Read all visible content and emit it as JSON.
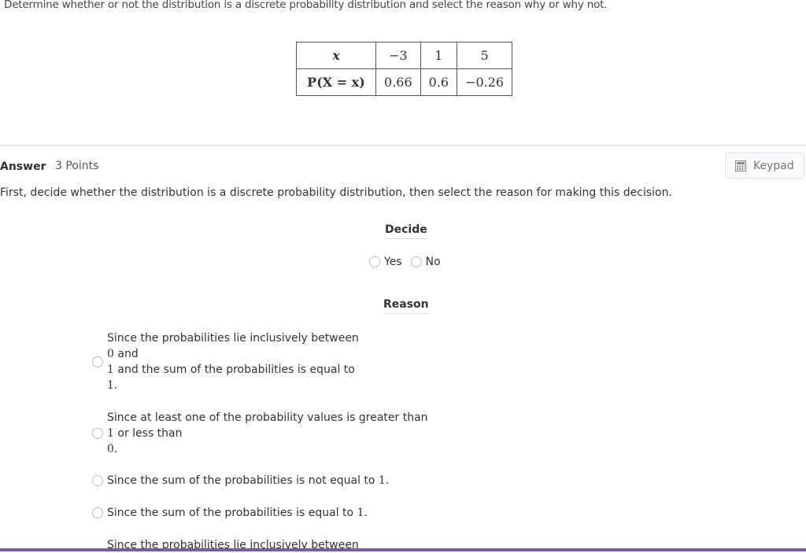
{
  "question": "Determine whether or not the distribution is a discrete probability distribution and select the reason why or why not.",
  "table": {
    "row_headers": [
      "x",
      "P(X = x)"
    ],
    "x_values": [
      "−3",
      "1",
      "5"
    ],
    "p_values": [
      "0.66",
      "0.6",
      "−0.26"
    ]
  },
  "answer": {
    "label": "Answer",
    "points": "3 Points",
    "keypad_label": "Keypad",
    "instructions": "First, decide whether the distribution is a discrete probability distribution, then select the reason for making this decision."
  },
  "decide": {
    "title": "Decide",
    "options": [
      "Yes",
      "No"
    ]
  },
  "reason": {
    "title": "Reason",
    "options": [
      {
        "line1": "Since the probabilities lie inclusively between",
        "n1": "0",
        "t2": " and",
        "n2": "1",
        "t3": " and the sum of the probabilities is equal to",
        "n3": "1",
        "t4": "."
      },
      {
        "line1": "Since at least one of the probability values is greater than",
        "n1": "1",
        "t2": " or less than",
        "n2": "0",
        "t3": "."
      },
      {
        "text": "Since the sum of the probabilities is not equal to ",
        "n": "1",
        "end": "."
      },
      {
        "text": "Since the sum of the probabilities is equal to ",
        "n": "1",
        "end": "."
      },
      {
        "text": "Since the probabilities lie inclusively between"
      }
    ]
  },
  "colors": {
    "accent_bar": "#7b5aa6"
  }
}
